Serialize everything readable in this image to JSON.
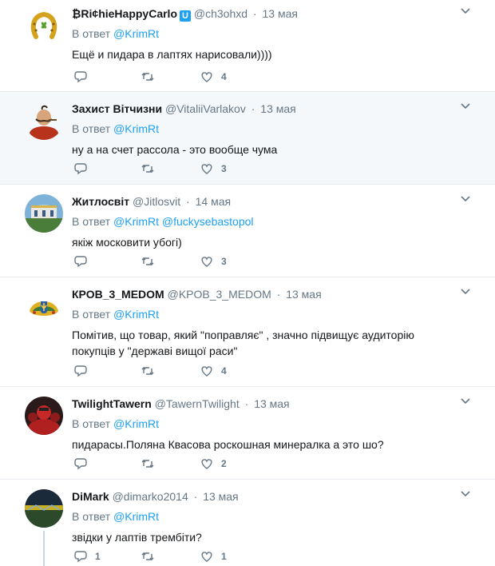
{
  "reply_prefix": "В ответ",
  "tweets": [
    {
      "name": "₿Ri¢hieHappyCarlo",
      "verified_glyph": "U",
      "handle": "@ch3ohxd",
      "sep": "·",
      "date": "13 мая",
      "reply_to": "@KrimRt",
      "reply_to_2": "",
      "text": "Ещё и пидара в лаптях нарисовали))))",
      "reply_count": "",
      "retweet_count": "",
      "like_count": "4"
    },
    {
      "name": "Захист Вітчизни",
      "handle": "@VitaliiVarlakov",
      "sep": "·",
      "date": "13 мая",
      "reply_to": "@KrimRt",
      "reply_to_2": "",
      "text": "ну а на счет рассола - это вообще чума",
      "reply_count": "",
      "retweet_count": "",
      "like_count": "3"
    },
    {
      "name": "Житлосвіт",
      "handle": "@Jitlosvit",
      "sep": "·",
      "date": "14 мая",
      "reply_to": "@KrimRt",
      "reply_to_2": "@fuckysebastopol",
      "text": "якіж московити убогі)",
      "reply_count": "",
      "retweet_count": "",
      "like_count": "3"
    },
    {
      "name": "КРОВ_3_MEDOM",
      "handle": "@KPOB_3_MEDOM",
      "sep": "·",
      "date": "13 мая",
      "reply_to": "@KrimRt",
      "reply_to_2": "",
      "text": "Помітив, що товар, який \"поправляє\" , значно підвищує аудиторію покупців у \"державі вищої раси\"",
      "reply_count": "",
      "retweet_count": "",
      "like_count": "4"
    },
    {
      "name": "TwilightTawern",
      "handle": "@TawernTwilight",
      "sep": "·",
      "date": "13 мая",
      "reply_to": "@KrimRt",
      "reply_to_2": "",
      "text": "пидарасы.Поляна Квасова роскошная минералка а это шо?",
      "reply_count": "",
      "retweet_count": "",
      "like_count": "2"
    },
    {
      "name": "DiMark",
      "handle": "@dimarko2014",
      "sep": "·",
      "date": "13 мая",
      "reply_to": "@KrimRt",
      "reply_to_2": "",
      "text": "звідки у лаптів трембіти?",
      "reply_count": "1",
      "retweet_count": "",
      "like_count": "1"
    }
  ],
  "icons": {
    "reply": "reply-icon",
    "retweet": "retweet-icon",
    "like": "heart-icon",
    "more": "chevron-down-icon"
  },
  "colors": {
    "link": "#1da1f2",
    "muted": "#657786",
    "highlight_bg": "#f5f8fa",
    "border": "#e6ecf0"
  }
}
